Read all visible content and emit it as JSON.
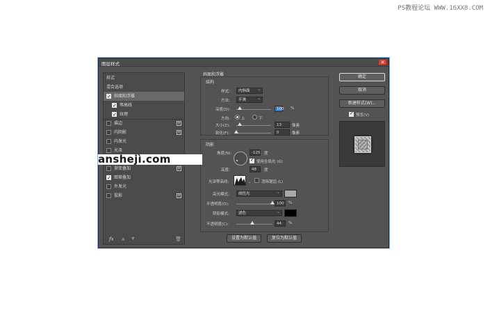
{
  "watermark": "PS教程论坛 WWW.16XX8.COM",
  "dialog": {
    "title": "图层样式",
    "close": "✕"
  },
  "left_panel": {
    "items": [
      {
        "label": "样式",
        "checkbox": false,
        "checked": false,
        "plus": false
      },
      {
        "label": "混合选项",
        "checkbox": false,
        "checked": false,
        "plus": false
      },
      {
        "label": "斜面和浮雕",
        "checkbox": true,
        "checked": true,
        "plus": false,
        "selected": true
      },
      {
        "label": "等高线",
        "checkbox": true,
        "checked": true,
        "plus": false,
        "sub": true
      },
      {
        "label": "纹理",
        "checkbox": true,
        "checked": true,
        "plus": false,
        "sub": true
      },
      {
        "label": "描边",
        "checkbox": true,
        "checked": false,
        "plus": true
      },
      {
        "label": "内阴影",
        "checkbox": true,
        "checked": false,
        "plus": true
      },
      {
        "label": "内发光",
        "checkbox": true,
        "checked": false,
        "plus": false
      },
      {
        "label": "光泽",
        "checkbox": true,
        "checked": false,
        "plus": false
      },
      {
        "label": "颜色叠加",
        "checkbox": true,
        "checked": false,
        "plus": true
      },
      {
        "label": "渐变叠加",
        "checkbox": true,
        "checked": false,
        "plus": true
      },
      {
        "label": "图案叠加",
        "checkbox": true,
        "checked": true,
        "plus": false
      },
      {
        "label": "外发光",
        "checkbox": true,
        "checked": false,
        "plus": false
      },
      {
        "label": "投影",
        "checkbox": true,
        "checked": false,
        "plus": true
      }
    ],
    "fx": "fx"
  },
  "bevel": {
    "section_title": "斜面和浮雕",
    "structure_title": "结构",
    "style_label": "样式:",
    "style_value": "内斜面",
    "technique_label": "方法:",
    "technique_value": "平滑",
    "depth_label": "深度(D):",
    "depth_value": "100",
    "depth_unit": "%",
    "depth_level": 0.1,
    "direction_label": "方向:",
    "dir_up": "上",
    "dir_down": "下",
    "size_label": "大小(Z):",
    "size_value": "13",
    "size_unit": "像素",
    "size_level": 0.1,
    "soften_label": "软化(F):",
    "soften_value": "0",
    "soften_unit": "像素",
    "soften_level": 0.0
  },
  "shading": {
    "title": "阴影",
    "angle_label": "角度(N):",
    "angle_value": "-125",
    "angle_unit": "度",
    "global_light": "使用全局光 (G)",
    "altitude_label": "高度:",
    "altitude_value": "48",
    "altitude_unit": "度",
    "gloss_label": "光泽等高线:",
    "anti_alias": "消除锯齿 (L)",
    "highlight_mode_label": "高光模式:",
    "highlight_mode_value": "线性光",
    "highlight_color": "#a8a8a8",
    "highlight_opacity_label": "不透明度(O):",
    "highlight_opacity_value": "100",
    "highlight_opacity_unit": "%",
    "highlight_opacity_level": 1.0,
    "shadow_mode_label": "阴影模式:",
    "shadow_mode_value": "滤色",
    "shadow_color": "#000000",
    "shadow_opacity_label": "不透明度(C):",
    "shadow_opacity_value": "44",
    "shadow_opacity_unit": "%",
    "shadow_opacity_level": 0.44
  },
  "buttons": {
    "make_default": "设置为默认值",
    "reset_default": "复位为默认值",
    "ok": "确定",
    "cancel": "取消",
    "new_style": "新建样式(W)...",
    "preview": "预览(V)"
  },
  "overlay_text": "anshejì.com"
}
